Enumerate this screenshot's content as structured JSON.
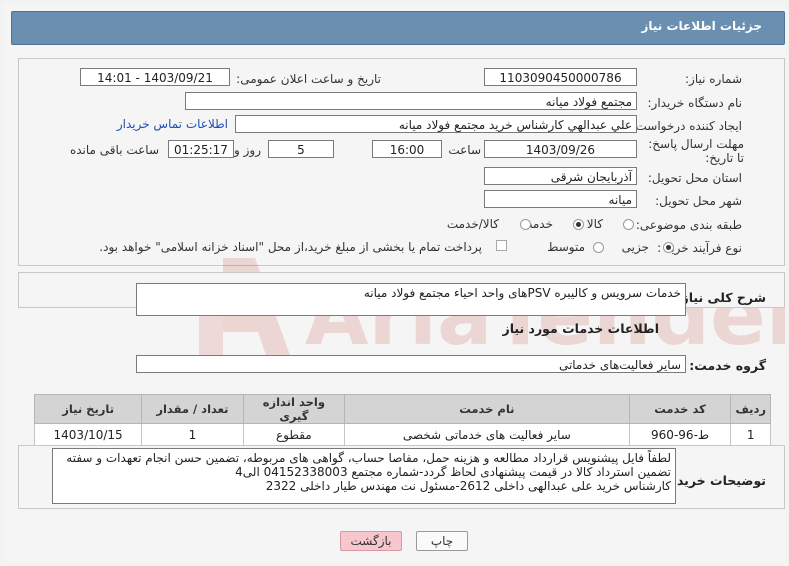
{
  "title": "جزئیات اطلاعات نیاز",
  "fields": {
    "need_number_label": "شماره نیاز:",
    "need_number": "1103090450000786",
    "announce_label": "تاریخ و ساعت اعلان عمومی:",
    "announce_value": "1403/09/21 - 14:01",
    "buyer_org_label": "نام دستگاه خریدار:",
    "buyer_org": "مجتمع فولاد میانه",
    "requester_label": "ایجاد کننده درخواست:",
    "requester": "علي عبدالهي كارشناس خريد مجتمع فولاد ميانه",
    "contact_link": "اطلاعات تماس خریدار",
    "deadline_label": "مهلت ارسال پاسخ: تا تاریخ:",
    "deadline_date": "1403/09/26",
    "time_label": "ساعت",
    "deadline_time": "16:00",
    "days_value": "5",
    "days_label": "روز و",
    "remaining_time": "01:25:17",
    "remaining_label": "ساعت باقی مانده",
    "province_label": "استان محل تحویل:",
    "province": "آذربایجان شرقی",
    "city_label": "شهر محل تحویل:",
    "city": "میانه",
    "category_label": "طبقه بندی موضوعی:",
    "category_options": [
      "کالا",
      "خدمت",
      "کالا/خدمت"
    ],
    "category_selected": "خدمت",
    "process_label": "نوع فرآیند خرید :",
    "process_options": [
      "جزیی",
      "متوسط"
    ],
    "process_selected": "جزیی",
    "payment_note": "پرداخت تمام یا بخشی از مبلغ خرید،از محل \"اسناد خزانه اسلامی\" خواهد بود."
  },
  "summary": {
    "label": "شرح کلی نیاز:",
    "text": "خدمات سرویس و کالیبره PSVهای واحد احیاء مجتمع فولاد میانه"
  },
  "services": {
    "section_title": "اطلاعات خدمات مورد نیاز",
    "group_label": "گروه خدمت:",
    "group_value": "سایر فعالیت‌های خدماتی",
    "columns": [
      "ردیف",
      "کد خدمت",
      "نام خدمت",
      "واحد اندازه گیری",
      "تعداد / مقدار",
      "تاریخ نیاز"
    ],
    "rows": [
      {
        "row": "1",
        "code": "ط-96-960",
        "name": "سایر فعالیت های خدماتی شخصی",
        "unit": "مقطوع",
        "qty": "1",
        "date": "1403/10/15"
      }
    ]
  },
  "notes": {
    "label": "توضیحات خریدار:",
    "lines": [
      "لطفاً فایل پیشنویس قرارداد مطالعه و هزینه حمل، مفاصا حساب، گواهی های مربوطه، تضمین حسن انجام تعهدات و سفته",
      "تضمین استرداد کالا در قیمت پیشنهادی لحاظ گردد-شماره مجتمع 04152338003 الی4",
      "کارشناس خرید علی عبدالهی داخلی 2612-مسئول نت مهندس طیار داخلی 2322"
    ]
  },
  "buttons": {
    "back": "بازگشت",
    "print": "چاپ"
  },
  "watermark": "AriaTender.net",
  "colors": {
    "title_bar": "#6b8fb0",
    "back_button": "#f7c7cd",
    "link": "#1a4fb5",
    "watermark": "#c0392b"
  }
}
